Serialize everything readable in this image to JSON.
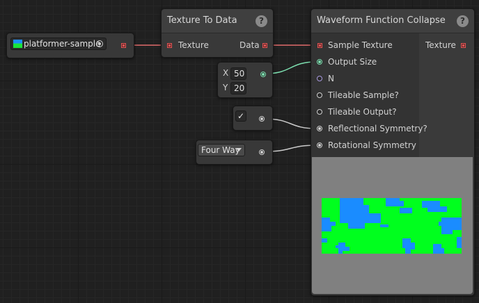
{
  "texture_asset": {
    "name": "platformer-sample"
  },
  "texture_to_data": {
    "title": "Texture To Data",
    "help": "?",
    "input_label": "Texture",
    "output_label": "Data"
  },
  "vector_node": {
    "x_label": "X",
    "x_value": "50",
    "y_label": "Y",
    "y_value": "20"
  },
  "toggle_node": {
    "checked": true,
    "check_glyph": "✓"
  },
  "enum_node": {
    "selected": "Four Way"
  },
  "wfc": {
    "title": "Waveform Function Collapse",
    "help": "?",
    "output_label": "Texture",
    "inputs": [
      {
        "label": "Sample Texture"
      },
      {
        "label": "Output Size"
      },
      {
        "label": "N"
      },
      {
        "label": "Tileable Sample?"
      },
      {
        "label": "Tileable Output?"
      },
      {
        "label": "Reflectional Symmetry?"
      },
      {
        "label": "Rotational Symmetry"
      }
    ]
  },
  "colors": {
    "texture_wire": "#e06a6a",
    "vector_wire": "#7de0b0",
    "default_wire": "#cccccc",
    "preview_green": "#00ff1e",
    "preview_blue": "#1a8cff"
  }
}
